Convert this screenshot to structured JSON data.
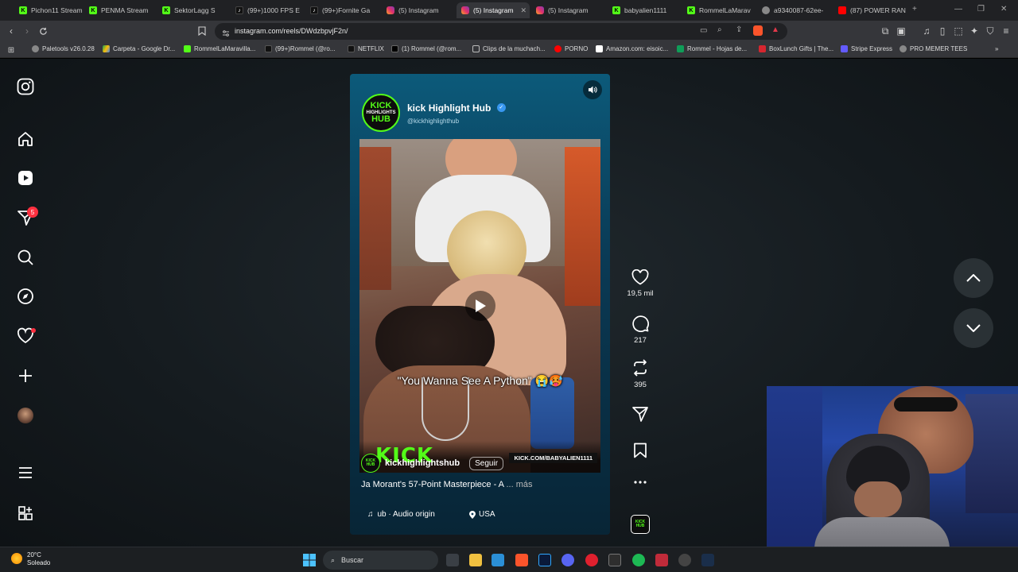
{
  "browser": {
    "tabs": [
      {
        "title": "Pichon11 Stream",
        "icon": "kick-icon"
      },
      {
        "title": "PENMA Stream",
        "icon": "kick-icon"
      },
      {
        "title": "SektorLagg S",
        "icon": "kick-icon"
      },
      {
        "title": "(99+)1000 FPS E",
        "icon": "tiktok-icon"
      },
      {
        "title": "(99+)Fornite Ga",
        "icon": "tiktok-icon"
      },
      {
        "title": "(5) Instagram",
        "icon": "instagram-icon"
      },
      {
        "title": "(5) Instagram",
        "icon": "instagram-icon",
        "active": true
      },
      {
        "title": "(5) Instagram",
        "icon": "instagram-icon"
      },
      {
        "title": "babyalien1111",
        "icon": "kick-icon"
      },
      {
        "title": "RommelLaMarav",
        "icon": "kick-icon"
      },
      {
        "title": "a9340087-62ee-",
        "icon": "globe-icon"
      },
      {
        "title": "(87) POWER RAN",
        "icon": "youtube-icon"
      }
    ],
    "url": "instagram.com/reels/DWdzbpvjF2n/",
    "bookmarks": [
      {
        "label": "Paletools v26.0.28"
      },
      {
        "label": "Carpeta - Google Dr..."
      },
      {
        "label": "RommelLaMaravilla..."
      },
      {
        "label": "(99+)Rommel (@ro..."
      },
      {
        "label": "NETFLIX"
      },
      {
        "label": "(1) Rommel (@rom..."
      },
      {
        "label": "Clips de la muchach..."
      },
      {
        "label": "PORNO"
      },
      {
        "label": "Amazon.com: eisoic..."
      },
      {
        "label": "Rommel - Hojas de..."
      },
      {
        "label": "BoxLunch Gifts | The..."
      },
      {
        "label": "Stripe Express"
      },
      {
        "label": "PRO MEMER TEES"
      }
    ]
  },
  "sidebar": {
    "notification_count": "5"
  },
  "reel": {
    "account_name": "kick Highlight Hub",
    "account_handle": "@kickhighlighthub",
    "logo_text": [
      "KICK",
      "HIGHLIGHTS",
      "HUB"
    ],
    "caption_overlay": "\"You Wanna See A Python\" 😭🥵",
    "kick_brand": "KICK",
    "kick_url": "KICK.COM/BABYALIEN1111",
    "owner_username": "kickhighlightshub",
    "follow_label": "Seguir",
    "description": "Ja Morant's 57-Point Masterpiece - A",
    "more_label": "... más",
    "audio": "ub · Audio origin",
    "location": "USA"
  },
  "actions": {
    "likes": "19,5 mil",
    "comments": "217",
    "reposts": "395"
  },
  "taskbar": {
    "temperature": "20°C",
    "weather": "Soleado",
    "search_placeholder": "Buscar"
  }
}
